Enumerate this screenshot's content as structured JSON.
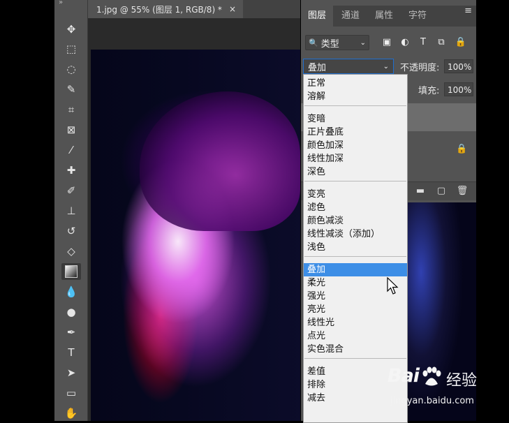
{
  "document": {
    "tab_title": "1.jpg @ 55% (图层 1, RGB/8) *",
    "close_glyph": "×"
  },
  "toolbar": {
    "collapse_glyph": "»",
    "tools": [
      {
        "name": "move-tool-icon",
        "glyph": "✥"
      },
      {
        "name": "marquee-tool-icon",
        "glyph": "⬚"
      },
      {
        "name": "lasso-tool-icon",
        "glyph": "◌"
      },
      {
        "name": "quick-select-tool-icon",
        "glyph": "✎"
      },
      {
        "name": "crop-tool-icon",
        "glyph": "⌗"
      },
      {
        "name": "frame-tool-icon",
        "glyph": "⊠"
      },
      {
        "name": "eyedropper-tool-icon",
        "glyph": "⁄"
      },
      {
        "name": "healing-brush-tool-icon",
        "glyph": "✚"
      },
      {
        "name": "brush-tool-icon",
        "glyph": "✐"
      },
      {
        "name": "stamp-tool-icon",
        "glyph": "⊥"
      },
      {
        "name": "history-brush-tool-icon",
        "glyph": "↺"
      },
      {
        "name": "eraser-tool-icon",
        "glyph": "◇"
      },
      {
        "name": "gradient-tool-icon",
        "glyph": ""
      },
      {
        "name": "blur-tool-icon",
        "glyph": "💧"
      },
      {
        "name": "dodge-tool-icon",
        "glyph": "●"
      },
      {
        "name": "pen-tool-icon",
        "glyph": "✒"
      },
      {
        "name": "type-tool-icon",
        "glyph": "T"
      },
      {
        "name": "path-select-tool-icon",
        "glyph": "➤"
      },
      {
        "name": "rectangle-tool-icon",
        "glyph": "▭"
      },
      {
        "name": "hand-tool-icon",
        "glyph": "✋"
      }
    ]
  },
  "panel": {
    "tabs": [
      "图层",
      "通道",
      "属性",
      "字符"
    ],
    "menu_glyph": "≡",
    "filter_label": "类型",
    "filter_icon": "🔍",
    "filter_icons": [
      "▣",
      "◐",
      "T",
      "⧉",
      "🔒"
    ],
    "blend_mode": "叠加",
    "opacity_label": "不透明度:",
    "opacity_value": "100%",
    "fill_label": "填充:",
    "fill_value": "100%",
    "lock_glyph": "🔒",
    "footer_icons": [
      "▬",
      "▢",
      "🗑"
    ]
  },
  "blend_menu": {
    "groups": [
      [
        "正常",
        "溶解"
      ],
      [
        "变暗",
        "正片叠底",
        "颜色加深",
        "线性加深",
        "深色"
      ],
      [
        "变亮",
        "滤色",
        "颜色减淡",
        "线性减淡（添加）",
        "浅色"
      ],
      [
        "叠加",
        "柔光",
        "强光",
        "亮光",
        "线性光",
        "点光",
        "实色混合"
      ],
      [
        "差值",
        "排除",
        "减去"
      ]
    ],
    "selected": "叠加"
  },
  "watermark": {
    "logo": "Bai",
    "logo_suffix": "经验",
    "url": "jingyan.baidu.com"
  },
  "colors": {
    "toolbar_bg": "#535353",
    "panel_bg": "#535353",
    "menu_bg": "#f0f0f0",
    "selection": "#3d8ee6"
  }
}
